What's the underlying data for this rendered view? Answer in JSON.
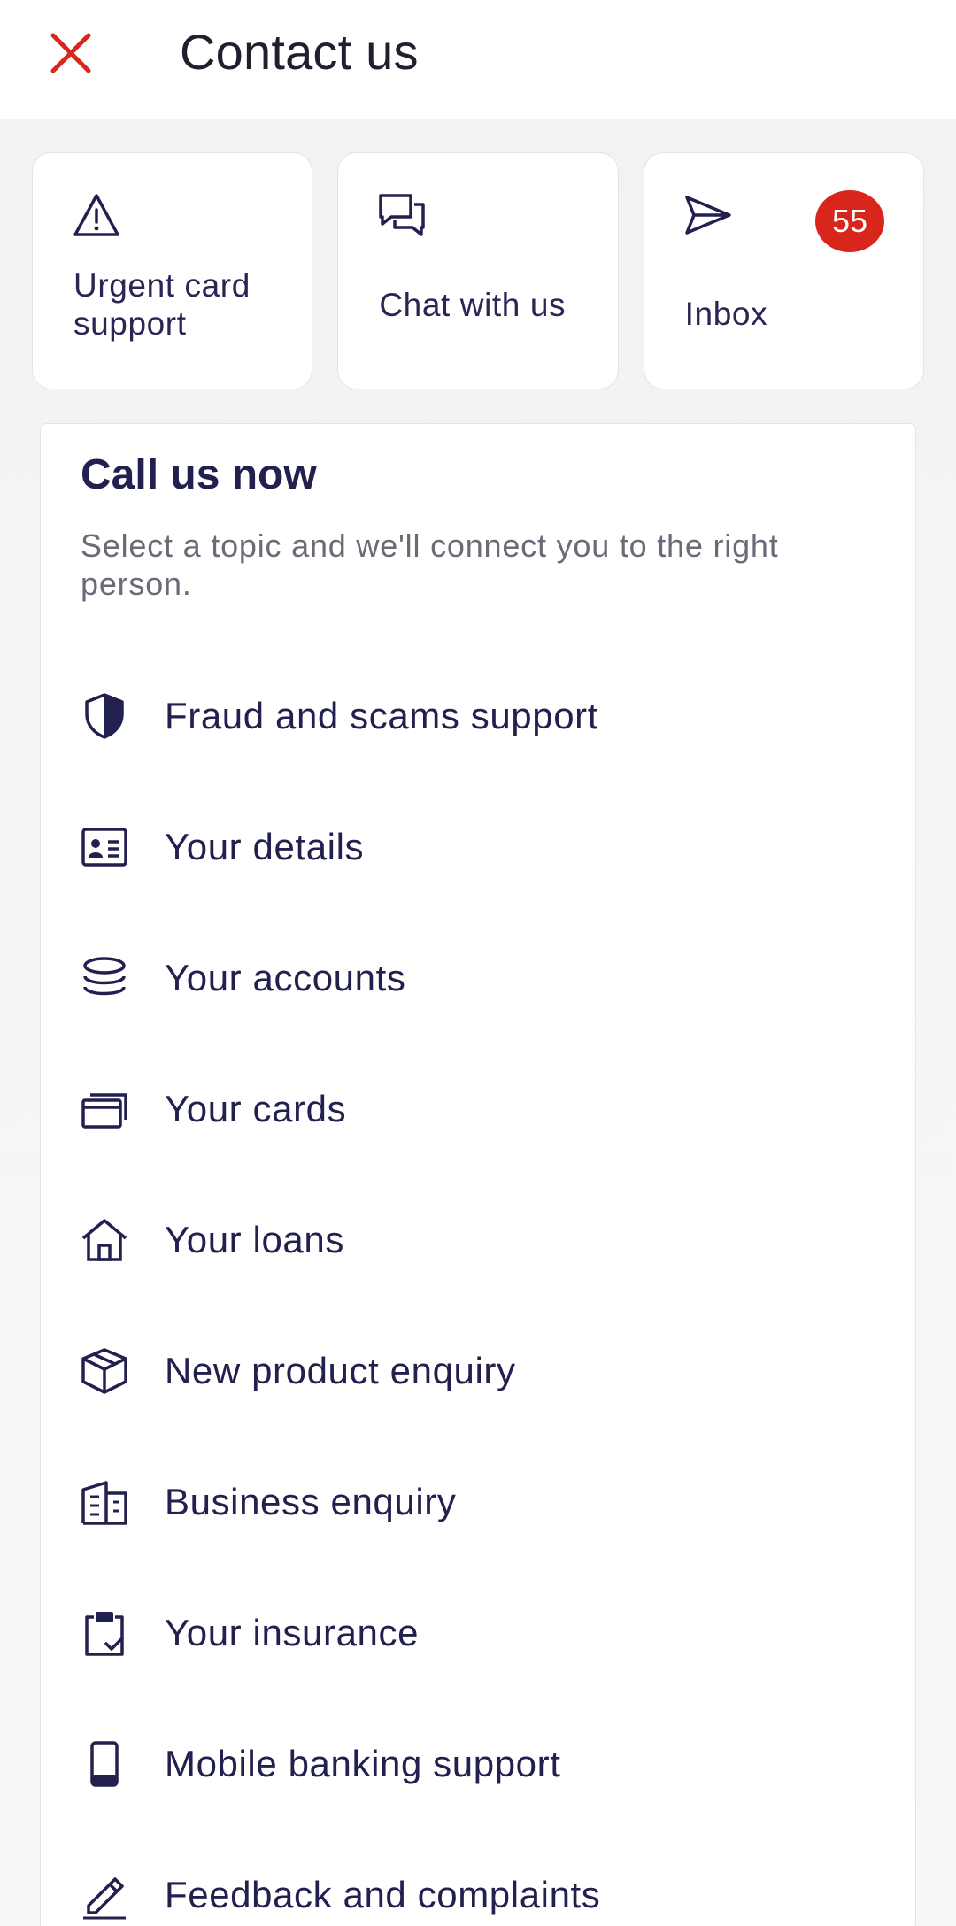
{
  "header": {
    "title": "Contact us",
    "close_icon": "close-icon",
    "close_color": "#d9261c"
  },
  "quick_actions": [
    {
      "label_line1": "Urgent card",
      "label_line2": "support",
      "icon": "warning-triangle-icon"
    },
    {
      "label": "Chat with us",
      "icon": "chat-bubbles-icon"
    },
    {
      "label": "Inbox",
      "icon": "send-icon",
      "badge": "55",
      "badge_color": "#d9261c"
    }
  ],
  "call_section": {
    "title": "Call us now",
    "subtitle": "Select a topic and we'll connect you to the right person.",
    "topics": [
      {
        "label": "Fraud and scams support",
        "icon": "shield-icon"
      },
      {
        "label": "Your details",
        "icon": "id-card-icon"
      },
      {
        "label": "Your accounts",
        "icon": "coins-stack-icon"
      },
      {
        "label": "Your cards",
        "icon": "cards-icon"
      },
      {
        "label": "Your loans",
        "icon": "house-icon"
      },
      {
        "label": "New product enquiry",
        "icon": "box-icon"
      },
      {
        "label": "Business enquiry",
        "icon": "building-icon"
      },
      {
        "label": "Your insurance",
        "icon": "clipboard-check-icon"
      },
      {
        "label": "Mobile banking support",
        "icon": "mobile-phone-icon"
      },
      {
        "label": "Feedback and complaints",
        "icon": "pencil-icon"
      }
    ]
  },
  "colors": {
    "text_primary": "#22204f",
    "accent_red": "#d9261c",
    "background": "#f3f4f6"
  }
}
